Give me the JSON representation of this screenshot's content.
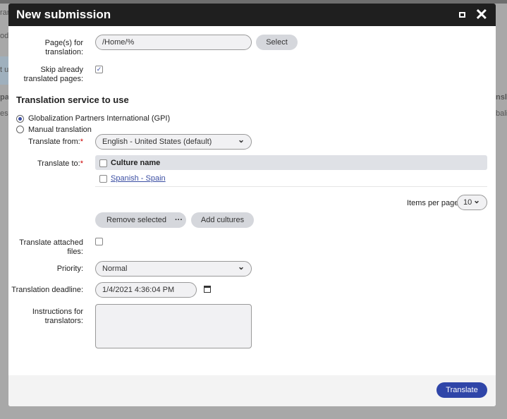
{
  "background": {
    "fragments_left": [
      "ran",
      "oda",
      "t u",
      "pa",
      "ess"
    ],
    "fragments_right": [
      "nsla",
      "baliz"
    ]
  },
  "modal": {
    "title": "New submission"
  },
  "form": {
    "pages_label": "Page(s) for translation:",
    "pages_value": "/Home/%",
    "select_label": "Select",
    "skip_label": "Skip already translated pages:",
    "skip_checked": true,
    "service_heading": "Translation service to use",
    "service_options": [
      {
        "label": "Globalization Partners International (GPI)",
        "selected": true
      },
      {
        "label": "Manual translation",
        "selected": false
      }
    ],
    "from_label": "Translate from:",
    "from_value": "English - United States (default)",
    "to_label": "Translate to:",
    "culture_header": "Culture name",
    "cultures": [
      {
        "name": "Spanish - Spain",
        "checked": false
      }
    ],
    "items_per_page_label": "Items per page",
    "items_per_page": "10",
    "remove_selected": "Remove selected",
    "more": "···",
    "add_cultures": "Add cultures",
    "attach_label": "Translate attached files:",
    "attach_checked": false,
    "priority_label": "Priority:",
    "priority_value": "Normal",
    "deadline_label": "Translation deadline:",
    "deadline_value": "1/4/2021 4:36:04 PM",
    "instructions_label": "Instructions for translators:",
    "instructions_value": "",
    "required_mark": "*"
  },
  "footer": {
    "translate": "Translate"
  }
}
